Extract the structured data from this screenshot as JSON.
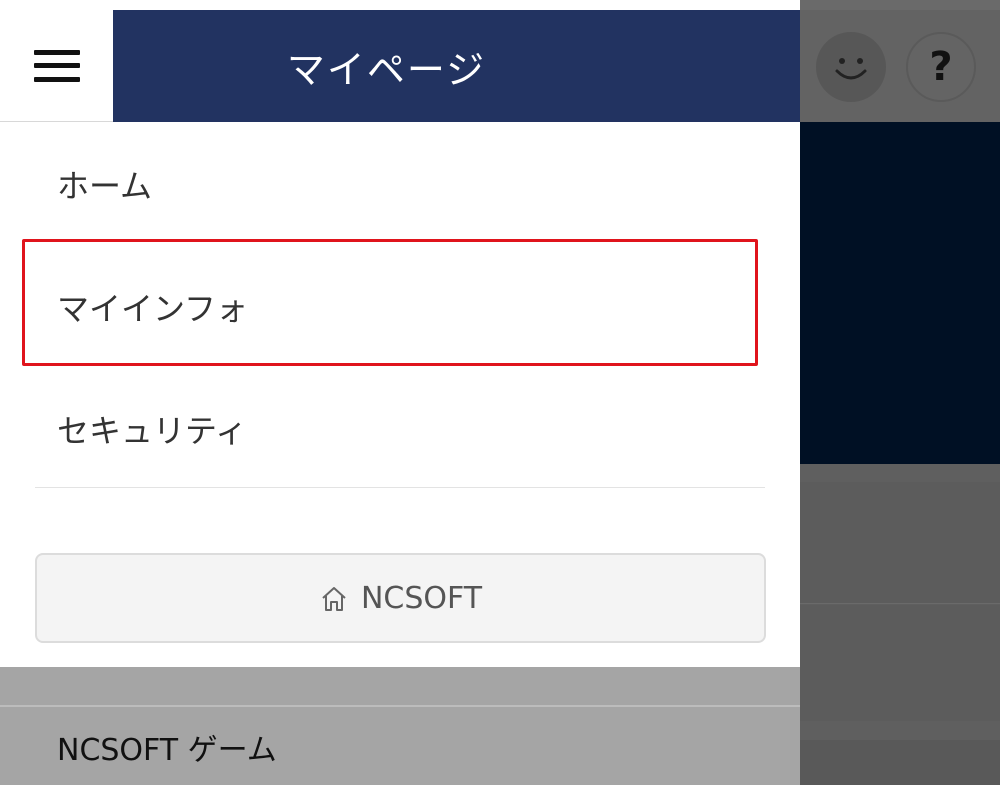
{
  "header": {
    "title": "マイページ",
    "menu_icon": "hamburger-menu-icon",
    "accent_color": "#223361"
  },
  "nav": {
    "items": [
      {
        "label": "ホーム"
      },
      {
        "label": "マイインフォ"
      },
      {
        "label": "セキュリティ"
      }
    ],
    "highlight_color": "#e0141c"
  },
  "ncsoft_button": {
    "label": "NCSOFT",
    "icon": "home-icon"
  },
  "games_section": {
    "label": "NCSOFT ゲーム"
  },
  "background_page": {
    "help_label": "?",
    "icons": [
      "smiley-icon",
      "help-icon"
    ]
  }
}
